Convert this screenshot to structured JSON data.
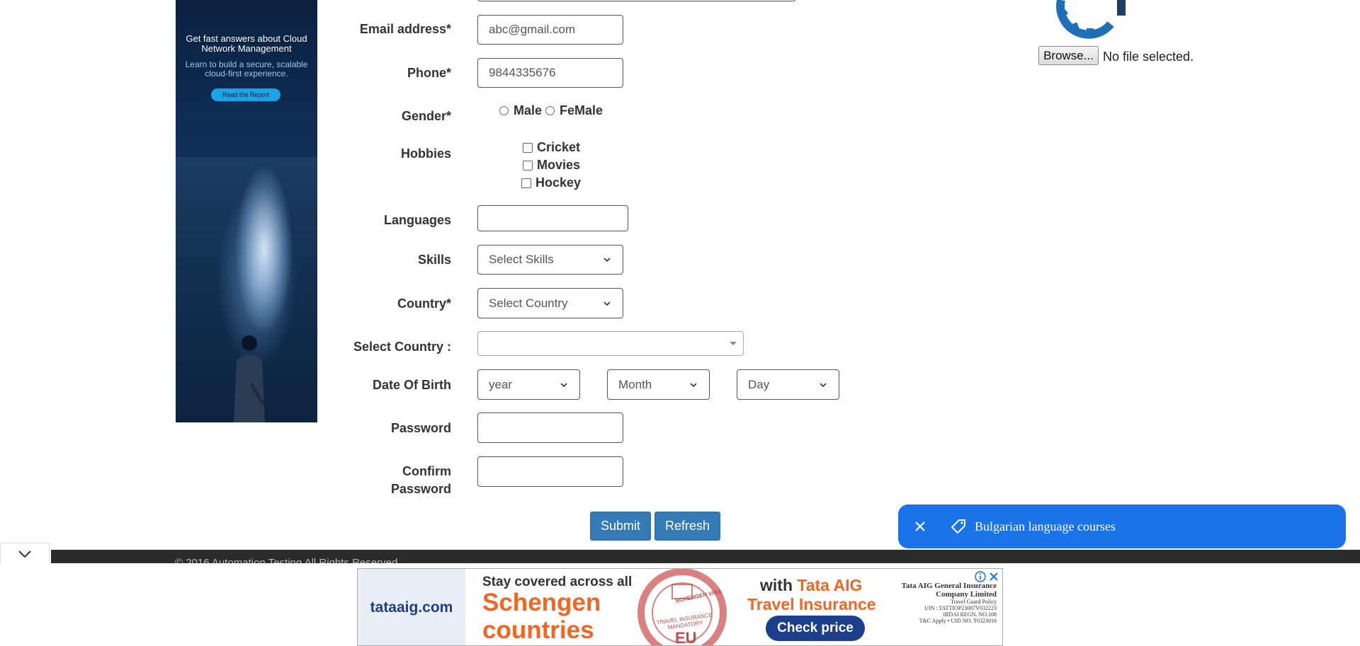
{
  "side_ad": {
    "headline": "Get fast answers about Cloud Network Management",
    "subtext": "Learn to build a secure, scalable cloud-first experience.",
    "cta": "Read the Report"
  },
  "form": {
    "email": {
      "label": "Email address*",
      "value": "abc@gmail.com"
    },
    "phone": {
      "label": "Phone*",
      "value": "9844335676"
    },
    "gender": {
      "label": "Gender*",
      "options": [
        "Male",
        "FeMale"
      ]
    },
    "hobbies": {
      "label": "Hobbies",
      "options": [
        "Cricket",
        "Movies",
        "Hockey"
      ]
    },
    "languages": {
      "label": "Languages",
      "value": ""
    },
    "skills": {
      "label": "Skills",
      "selected": "Select Skills"
    },
    "country": {
      "label": "Country*",
      "selected": "Select Country"
    },
    "select_country": {
      "label": "Select Country :",
      "selected": ""
    },
    "dob": {
      "label": "Date Of Birth",
      "year": "year",
      "month": "Month",
      "day": "Day"
    },
    "password": {
      "label": "Password",
      "value": ""
    },
    "confirm_password": {
      "label_line1": "Confirm",
      "label_line2": "Password",
      "value": ""
    },
    "submit": "Submit",
    "refresh": "Refresh"
  },
  "upload": {
    "browse": "Browse...",
    "status": "No file selected."
  },
  "footer": {
    "copyright": "© 2016 Automation Testing All Rights Reserved"
  },
  "toast": {
    "text": "Bulgarian language courses",
    "icons": [
      "close-icon",
      "tag-icon"
    ]
  },
  "bottom_ad": {
    "brand": "tataaig.com",
    "line1": "Stay covered across all",
    "line2": "Schengen",
    "line3": "countries",
    "stamp": "SCHENGEN VISA",
    "stamp_inner": "TRAVEL INSURANCE MANDATORY",
    "stamp_eu": "EU",
    "with_text": "with ",
    "brand_text": "Tata AIG",
    "line_b": "Travel Insurance",
    "cta": "Check price",
    "legal": [
      "Tata AIG General Insurance",
      "Company Limited",
      "Travel Guard Policy",
      "UIN : TATTIOP23007V032223",
      "IRDAI REGN. NO.108",
      "T&C Apply • UID NO. T0323016"
    ]
  },
  "colors": {
    "button_blue": "#337ab7",
    "toast_blue": "#1a73e8",
    "gear_blue": "#1e6fb8",
    "footer_dark": "#2b2b2b",
    "ad_orange": "#f26522",
    "ad_navy": "#1b3f8b"
  }
}
